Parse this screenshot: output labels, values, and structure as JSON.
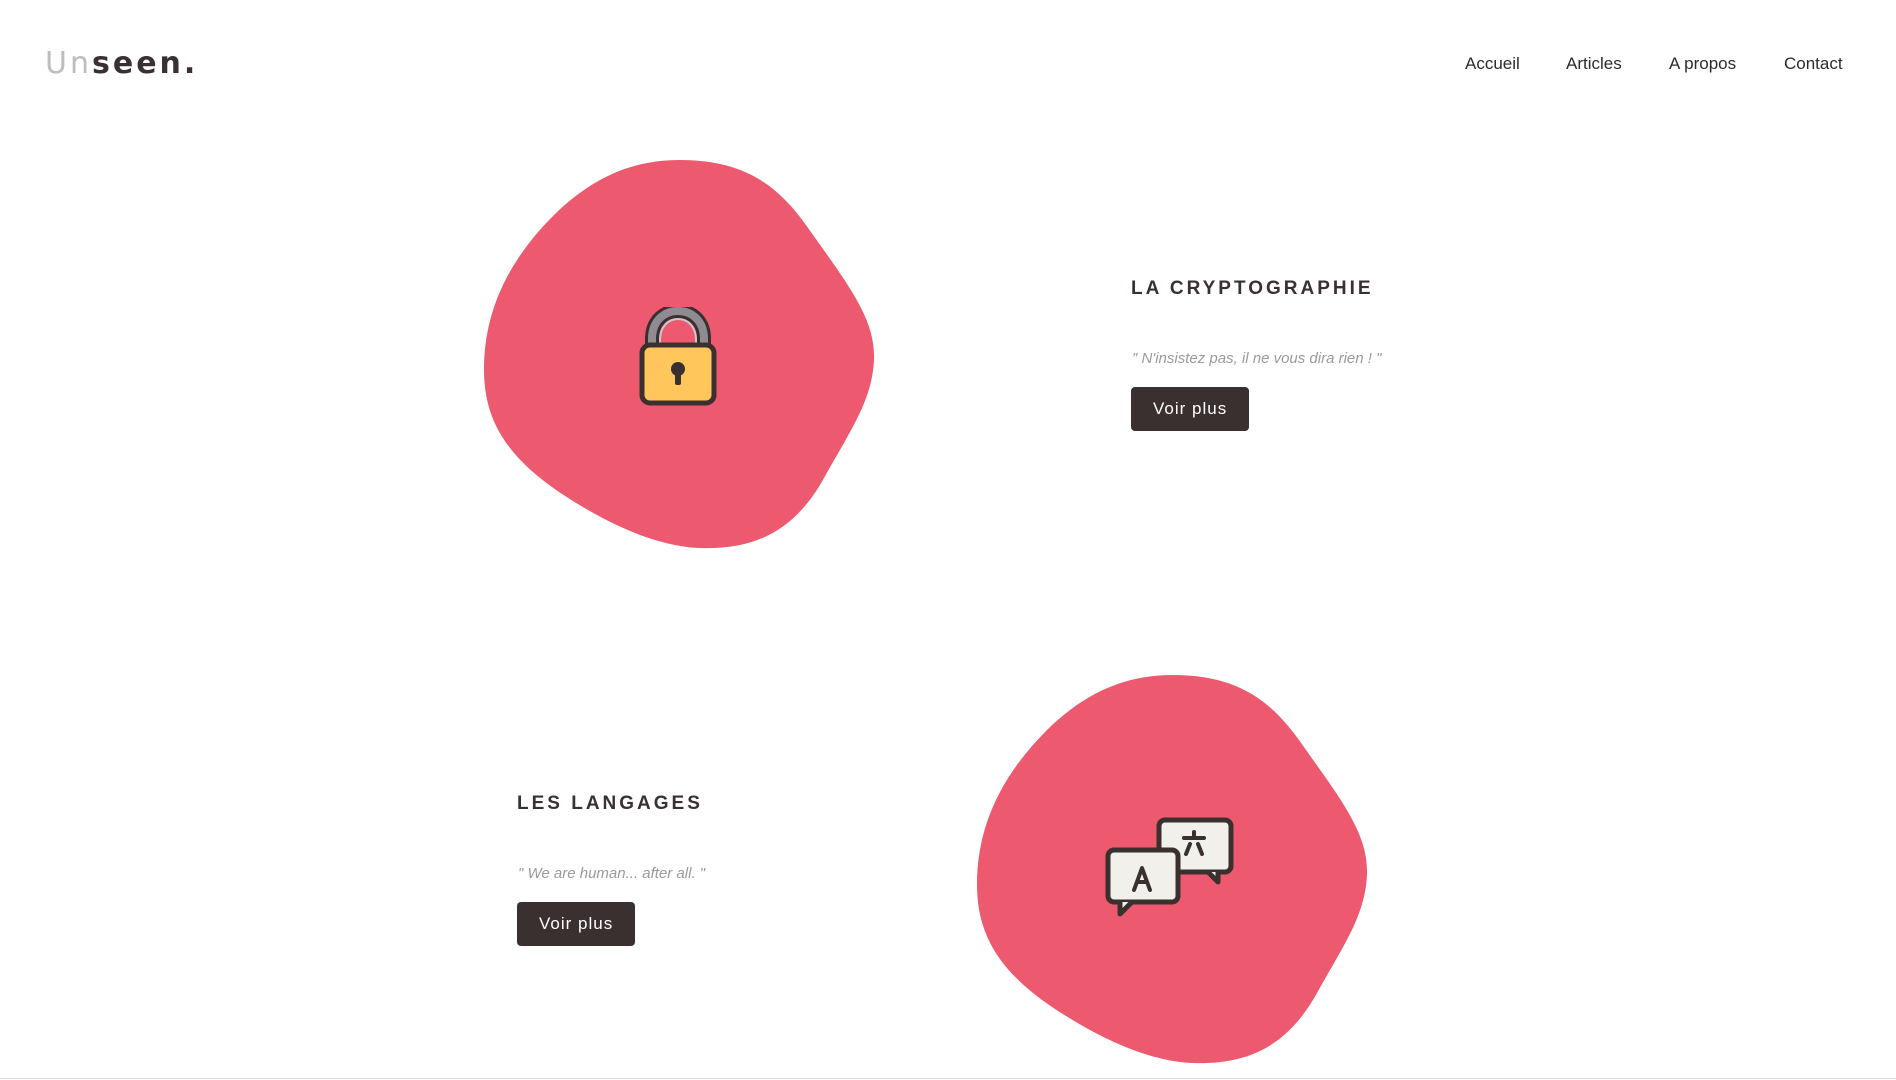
{
  "header": {
    "logo": {
      "part_light": "Un",
      "part_dark": "seen",
      "dot": "."
    },
    "nav": [
      {
        "label": "Accueil"
      },
      {
        "label": "Articles"
      },
      {
        "label": "A propos"
      },
      {
        "label": "Contact"
      }
    ]
  },
  "sections": [
    {
      "title": "LA CRYPTOGRAPHIE",
      "quote": "\" N'insistez pas, il ne vous dira rien ! \"",
      "button_label": "Voir plus",
      "icon": "padlock-icon"
    },
    {
      "title": "LES LANGAGES",
      "quote": "\" We are human... after all. \"",
      "button_label": "Voir plus",
      "icon": "translate-chat-icon"
    }
  ],
  "colors": {
    "blob": "#ed5a70",
    "dark": "#3b3030",
    "quote": "#9a9a9a",
    "padlock_body": "#ffc65c",
    "padlock_shackle": "#8e8b92",
    "bubble": "#f2f0ea"
  }
}
